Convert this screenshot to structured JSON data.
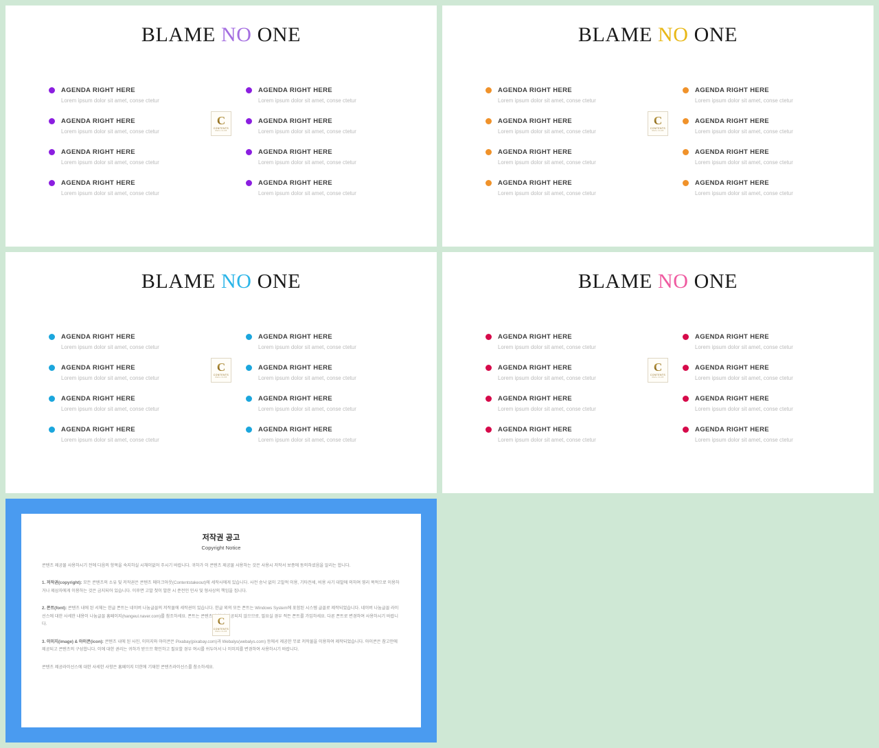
{
  "background_color": "#cfe8d5",
  "slide_background": "#ffffff",
  "agenda": {
    "title_prefix": "BLAME ",
    "title_accent": "NO",
    "title_suffix": " ONE",
    "item_title": "AGENDA RIGHT HERE",
    "item_desc": "Lorem ipsum dolor sit amet, conse ctetur",
    "items_per_column": 4,
    "logo": {
      "letter": "C",
      "word": "CONTENTS",
      "sub": "REAL   CLUB"
    }
  },
  "slides": [
    {
      "name": "slide-purple",
      "accent_color": "#a46ee0",
      "bullet_color": "#8b1ee0",
      "position": "top-left"
    },
    {
      "name": "slide-gold",
      "accent_color": "#e8b818",
      "bullet_color": "#f0922a",
      "position": "top-right"
    },
    {
      "name": "slide-cyan",
      "accent_color": "#2bb5e8",
      "bullet_color": "#1ba6dd",
      "position": "bottom-left"
    },
    {
      "name": "slide-pink",
      "accent_color": "#ef5aa0",
      "bullet_color": "#d60a4a",
      "position": "bottom-right"
    }
  ],
  "copyright_slide": {
    "frame_color": "#4a9bf0",
    "title": "저작권 공고",
    "subtitle": "Copyright Notice",
    "intro": "콘텐츠 제공물 사용하시기 전에 다음의 항목을 숙지하실 시채이없어 주시기 바랍니다. 귀하가 이 콘텐츠 제공물 사용하는 것은 사용시 저작서 보증에 동의하셨음을 알리는 합니다.",
    "sections": [
      {
        "label": "1. 저작권(copyright):",
        "body": "모든 콘텐츠의 소유 및 저작권은 콘텐츠 메이크아웃(Contentstakeout)에 세작사에게 있습니다. 사전 승낙 없이 고발적 이용, 기타전세, 비용 사기 대발에 의하여 영리 목적으로 이용하거나 제삼자에게 이용하는 것은 금지되어 있습니다. 이후면 고발 첫이 발한 시 준전인 민사 및 형사상의 책임을 집니다."
      },
      {
        "label": "2. 폰트(font):",
        "body": "콘텐츠 내에 된 서체는 한글 폰트는 네이버 나눔글꼴의 저작물에 세작권이 있습니다. 한글 외의 모든 폰트는 Windows System에 포함된 시스템 글꼴로 제작되었습니다. 네이버 나눔글꼴 라이선스에 대한 사세한 내용이 나눔글꼴 홈페이지(hangeul.naver.com)를 참조하세요. 폰트는 콘텐츠의 함께 제공되지 않으므로, 필요실 경우 적든 폰트를 가입하세요. 다른 폰트로 변경하여 사용하시기 바랍니다."
      },
      {
        "label": "3. 이미지(image) & 아이콘(icon):",
        "body": "콘텐츠 내에 된 사진, 이미지와 아이콘은 Pixabay(pixabay.com)과 Webalys(webalys.com) 등에서 제공한 무료 저작물을 이용하여 제작되었습니다. 아이콘은 참고만에 제공되고 콘텐츠의 구성합니다. 이에 대한 권리는 귀하가 받으므 확인하고 필요할 경우 여시를 쉬두어서 나 이미지를 변경하여 사용하시기 바랍니다."
      }
    ],
    "footer": "콘텐츠 제공라이선스에 대한 사세한 사항은 홈페이지 더한에 기재한 콘텐츠라이선스를 참소하세요."
  }
}
